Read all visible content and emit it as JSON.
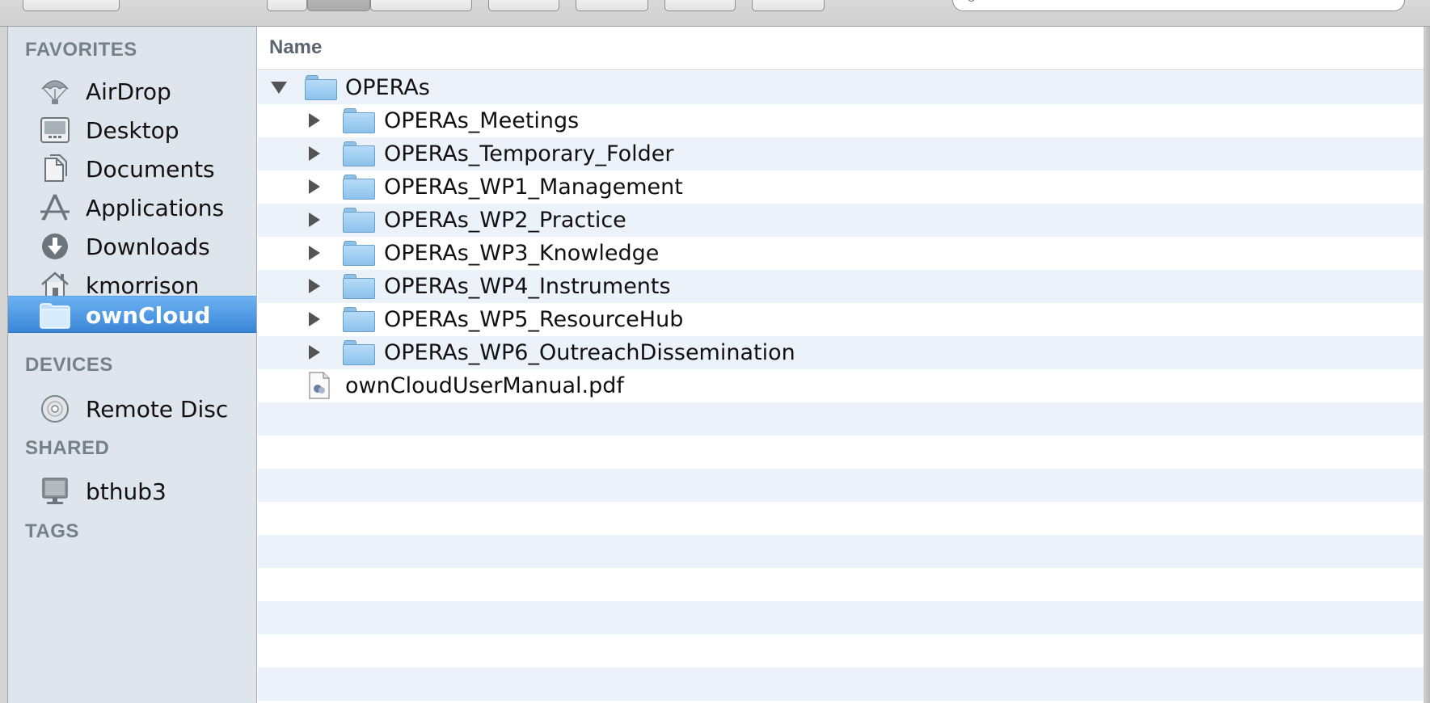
{
  "sidebar": {
    "sections": {
      "favorites": "FAVORITES",
      "devices": "DEVICES",
      "shared": "SHARED",
      "tags": "TAGS"
    },
    "favorites": [
      {
        "label": "AirDrop",
        "icon": "airdrop-icon"
      },
      {
        "label": "Desktop",
        "icon": "desktop-icon"
      },
      {
        "label": "Documents",
        "icon": "documents-icon"
      },
      {
        "label": "Applications",
        "icon": "applications-icon"
      },
      {
        "label": "Downloads",
        "icon": "downloads-icon"
      },
      {
        "label": "kmorrison",
        "icon": "home-icon"
      },
      {
        "label": "ownCloud",
        "icon": "folder-icon",
        "selected": true
      }
    ],
    "devices": [
      {
        "label": "Remote Disc",
        "icon": "disc-icon"
      }
    ],
    "shared": [
      {
        "label": "bthub3",
        "icon": "computer-icon"
      }
    ],
    "selected_color": "#3b86d8"
  },
  "list": {
    "column_header": "Name",
    "rows": [
      {
        "label": "OPERAs",
        "type": "folder",
        "expanded": true,
        "level": 0
      },
      {
        "label": "OPERAs_Meetings",
        "type": "folder",
        "expanded": false,
        "level": 1
      },
      {
        "label": "OPERAs_Temporary_Folder",
        "type": "folder",
        "expanded": false,
        "level": 1
      },
      {
        "label": "OPERAs_WP1_Management",
        "type": "folder",
        "expanded": false,
        "level": 1
      },
      {
        "label": "OPERAs_WP2_Practice",
        "type": "folder",
        "expanded": false,
        "level": 1
      },
      {
        "label": "OPERAs_WP3_Knowledge",
        "type": "folder",
        "expanded": false,
        "level": 1
      },
      {
        "label": "OPERAs_WP4_Instruments",
        "type": "folder",
        "expanded": false,
        "level": 1
      },
      {
        "label": "OPERAs_WP5_ResourceHub",
        "type": "folder",
        "expanded": false,
        "level": 1
      },
      {
        "label": "OPERAs_WP6_OutreachDissemination",
        "type": "folder",
        "expanded": false,
        "level": 1
      },
      {
        "label": "ownCloudUserManual.pdf",
        "type": "pdf",
        "level": 0
      }
    ],
    "stripe_color": "#ebf2fa"
  }
}
